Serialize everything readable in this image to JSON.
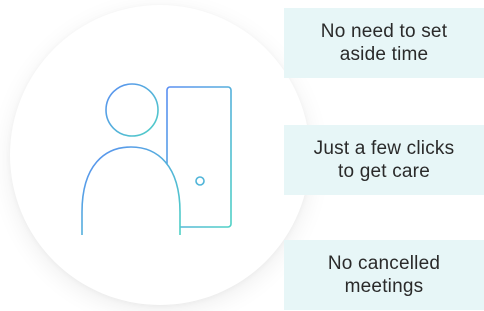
{
  "colors": {
    "accent_blue": "#5a8ef2",
    "accent_teal": "#4fd1c5",
    "card_background": "#e7f6f7",
    "text": "#2a2a2a"
  },
  "illustration": {
    "icon": "person-with-phone-icon"
  },
  "benefits": [
    {
      "line1": "No need to set",
      "line2": "aside time"
    },
    {
      "line1": "Just a few clicks",
      "line2": "to get care"
    },
    {
      "line1": "No cancelled",
      "line2": "meetings"
    }
  ]
}
